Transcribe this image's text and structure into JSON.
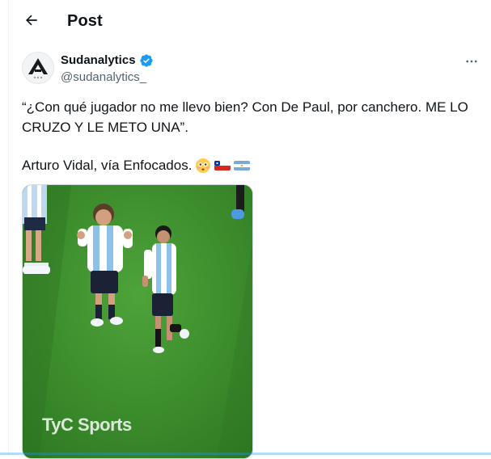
{
  "header": {
    "title": "Post",
    "back_icon": "arrow-left-icon"
  },
  "author": {
    "name": "Sudanalytics",
    "handle": "@sudanalytics_",
    "verified": true,
    "verified_color": "#1d9bf0"
  },
  "tweet": {
    "text": "“¿Con qué jugador no me llevo bien? Con De Paul, por canchero. ME LO CRUZO Y LE METO UNA”.",
    "text_line2": "Arturo Vidal, vía Enfocados.",
    "emojis": [
      "flushed-face",
      "flag-chile",
      "flag-argentina"
    ]
  },
  "media": {
    "type": "video",
    "watermark": "TyC Sports",
    "pitch_color": "#3b8a2c"
  },
  "colors": {
    "accent": "#1d9bf0",
    "text_primary": "#0f1419",
    "text_secondary": "#536471"
  }
}
